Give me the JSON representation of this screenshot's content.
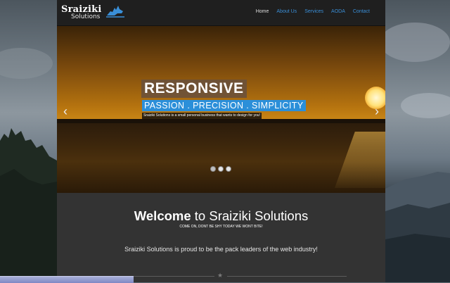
{
  "logo": {
    "text": "Sraiziki",
    "sub": "Solutions",
    "mascot_icon": "wolf-icon"
  },
  "nav": {
    "items": [
      {
        "label": "Home",
        "active": true
      },
      {
        "label": "About Us",
        "active": false
      },
      {
        "label": "Services",
        "active": false
      },
      {
        "label": "AODA",
        "active": false
      },
      {
        "label": "Contact",
        "active": false
      }
    ]
  },
  "hero": {
    "title": "RESPONSIVE",
    "subtitle": "PASSION . PRECISION . SIMPLICITY",
    "description": "Sraiziki Solutions is a small personal business that wants to design for you!",
    "prev_icon": "chevron-left-icon",
    "next_icon": "chevron-right-icon",
    "prev_glyph": "‹",
    "next_glyph": "›",
    "slides": 3,
    "active_slide": 1
  },
  "welcome": {
    "title_bold": "Welcome",
    "title_rest": " to Sraiziki Solutions",
    "tagline": "COME ON, DONT BE SHY TODAY WE WONT BITE!",
    "body": "Sraiziki Solutions is proud to be the pack leaders of the web industry!",
    "divider_icon": "star-icon",
    "divider_glyph": "★"
  },
  "colors": {
    "accent": "#2b8fd9",
    "nav_link": "#3a8fd8",
    "navbar_bg": "#1f1f1f",
    "content_bg": "#333333"
  }
}
